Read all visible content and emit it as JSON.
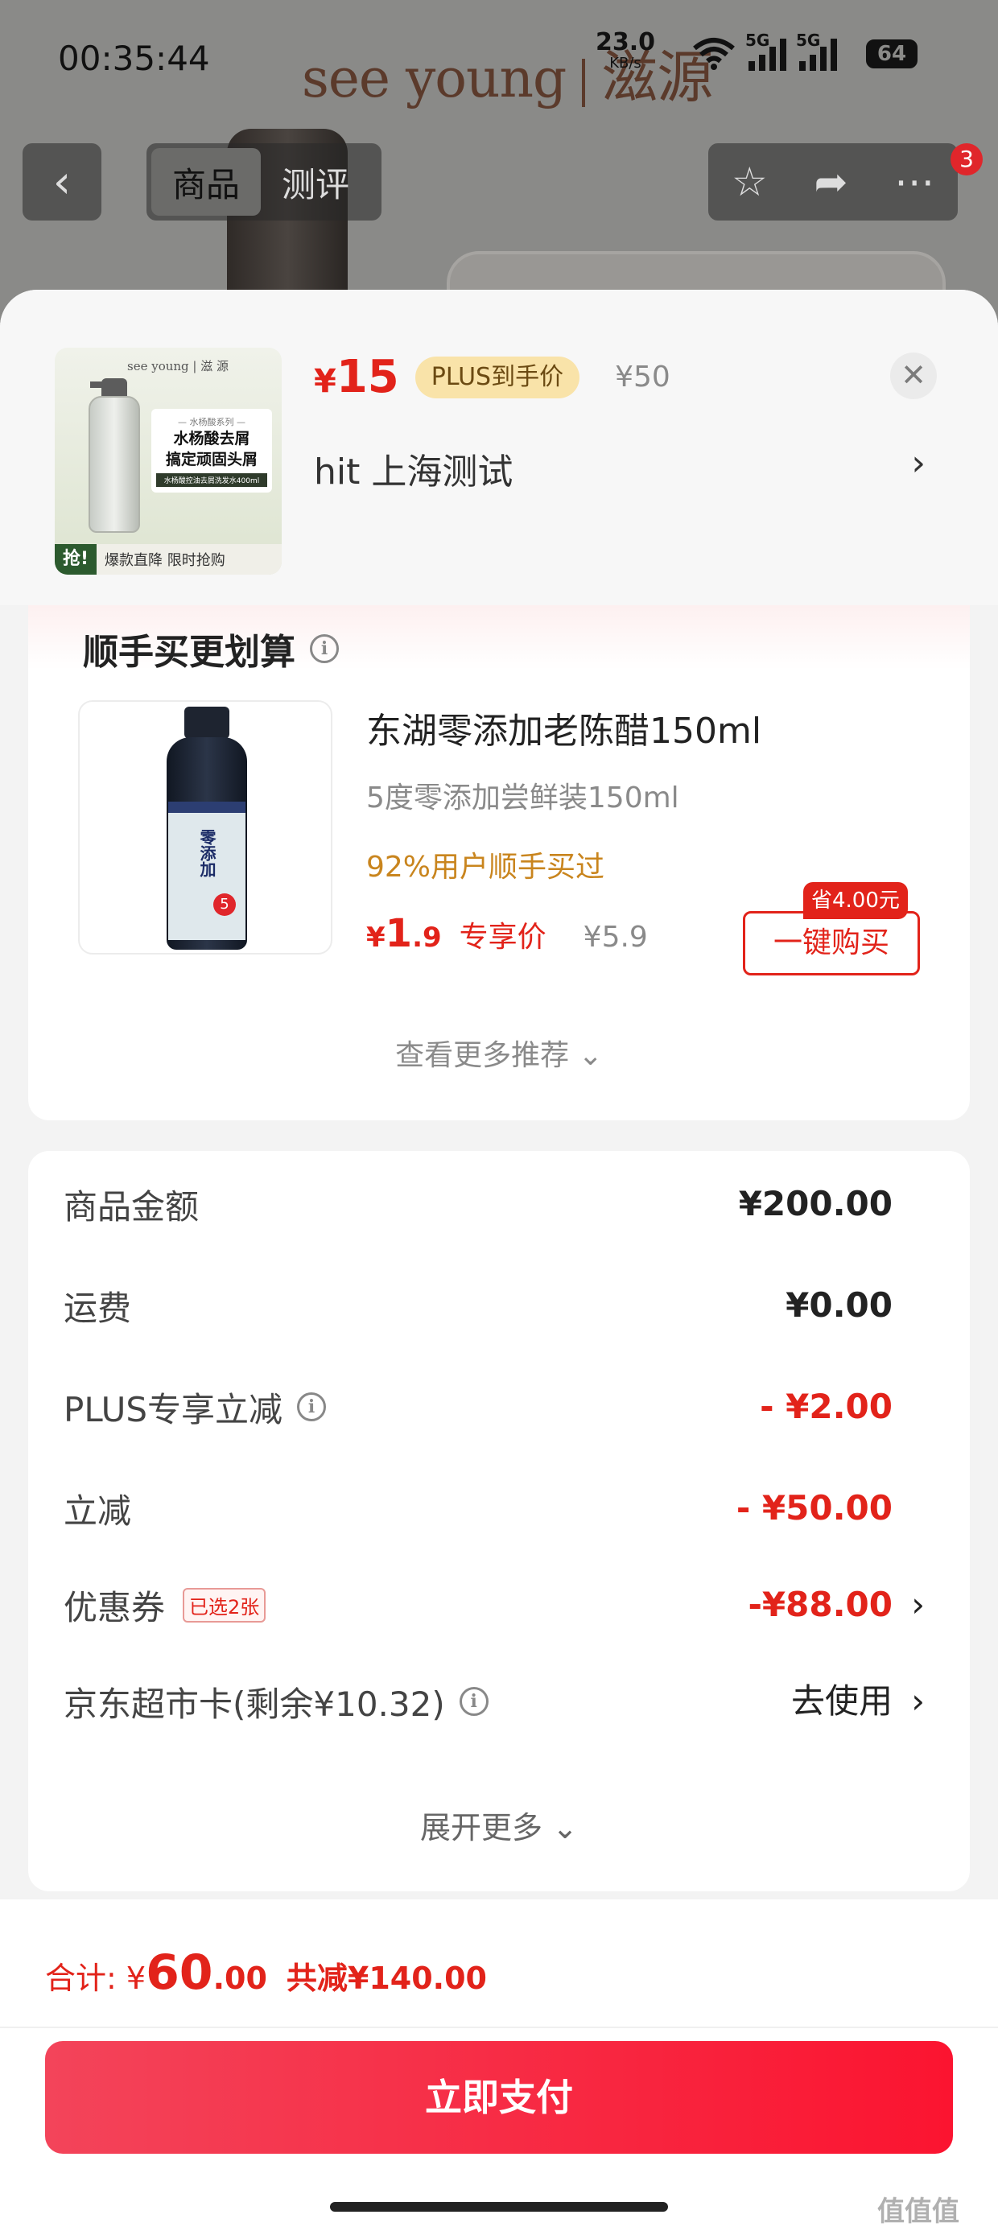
{
  "status_bar": {
    "time": "00:35:44",
    "net_speed": "23.0",
    "net_unit": "KB/s",
    "sig1_label": "5G",
    "sig2_label": "5G",
    "battery": "64"
  },
  "background": {
    "brand": "see young",
    "brand_cn": "滋源"
  },
  "nav": {
    "back_icon": "chevron-left-icon",
    "tabs": [
      {
        "label": "商品",
        "active": true
      },
      {
        "label": "测评",
        "active": false
      }
    ],
    "badge": "3"
  },
  "product": {
    "price_symbol": "¥",
    "price": "15",
    "plus_label": "PLUS到手价",
    "original_price": "¥50",
    "address": "hit  上海测试",
    "thumb": {
      "brand": "see young | 滋 源",
      "series": "— 水杨酸系列 —",
      "headline1": "水杨酸去屑",
      "headline2": "搞定顽固头屑",
      "sub": "水杨酸控油去屑洗发水400ml",
      "grab": "抢!",
      "strip": "爆款直降 限时抢购"
    }
  },
  "recommend": {
    "title": "顺手买更划算",
    "item": {
      "name": "东湖零添加老陈醋150ml",
      "spec": "5度零添加尝鲜装150ml",
      "rate": "92%用户顺手买过",
      "price_int": "1",
      "price_dec": ".9",
      "price_label": "专享价",
      "original_price": "¥5.9",
      "save_tag": "省4.00元",
      "buy_label": "一键购买",
      "bottle_text": "零添加",
      "bottle_num": "5"
    },
    "more_label": "查看更多推荐"
  },
  "costs": {
    "rows": [
      {
        "label": "商品金额",
        "value": "¥200.00"
      },
      {
        "label": "运费",
        "value": "¥0.00"
      },
      {
        "label": "PLUS专享立减",
        "value": "- ¥2.00"
      },
      {
        "label": "立减",
        "value": "- ¥50.00"
      },
      {
        "label": "优惠券",
        "tag": "已选2张",
        "value": "-¥88.00"
      },
      {
        "label": "京东超市卡(剩余¥10.32)",
        "value": "去使用"
      }
    ],
    "more_label": "展开更多"
  },
  "footer": {
    "total_label": "合计: ¥",
    "total_int": "60",
    "total_dec": ".00",
    "total_cut": "共减¥140.00",
    "pay_label": "立即支付",
    "watermark": "值值值"
  },
  "colors": {
    "accent_red": "#e2231a",
    "plus_gold": "#f9e3a9",
    "pay_gradient_start": "#f3445a",
    "pay_gradient_end": "#fb1430"
  }
}
